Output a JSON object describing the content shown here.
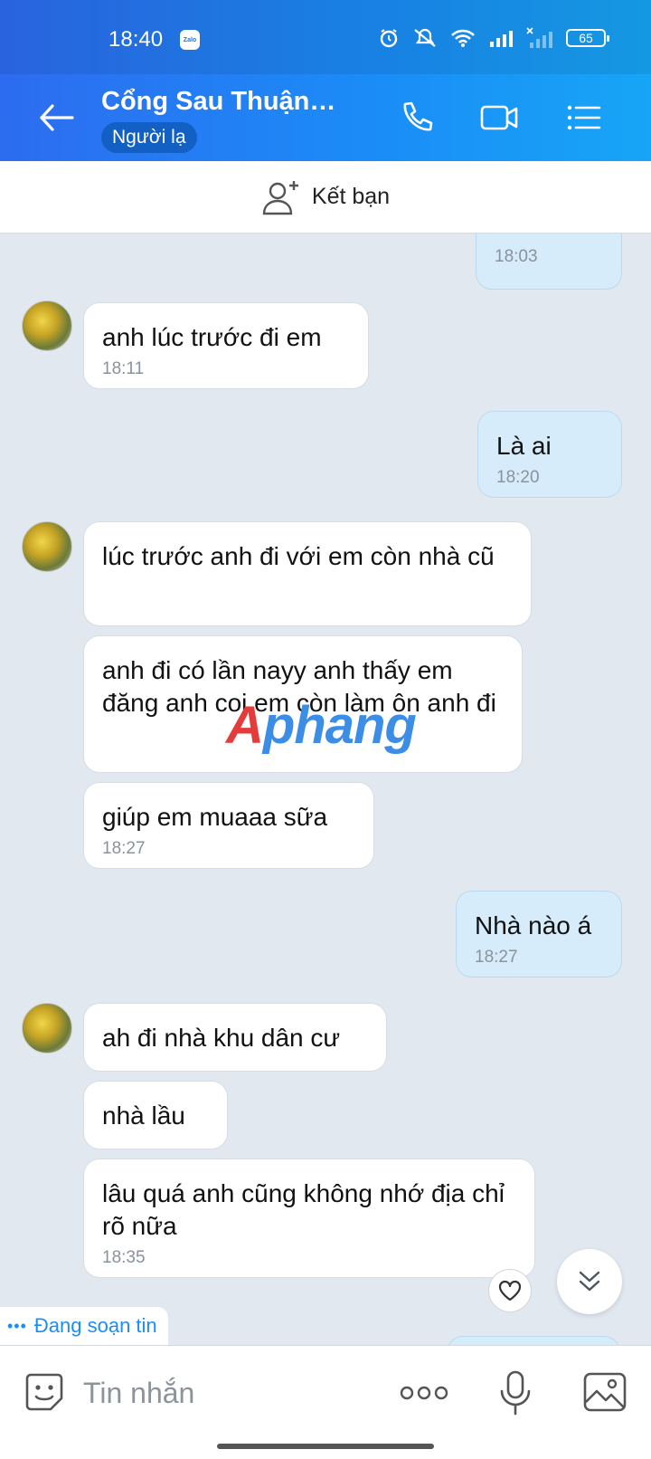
{
  "status_bar": {
    "time": "18:40",
    "app_badge": "Zalo",
    "battery": "65"
  },
  "header": {
    "title": "Cổng Sau Thuận…",
    "badge": "Người lạ"
  },
  "add_friend": {
    "label": "Kết bạn"
  },
  "messages": [
    {
      "dir": "out",
      "text": "",
      "time": "18:03"
    },
    {
      "dir": "in",
      "text": "anh lúc trước đi em",
      "time": "18:11"
    },
    {
      "dir": "out",
      "text": "Là ai",
      "time": "18:20"
    },
    {
      "dir": "in",
      "text": "lúc trước anh đi với em còn nhà cũ",
      "time": ""
    },
    {
      "dir": "in",
      "text": "anh đi có lần nayy anh thấy em đăng anh coi em còn làm ôn anh đi",
      "time": ""
    },
    {
      "dir": "in",
      "text": "giúp em muaaa sữa",
      "time": "18:27"
    },
    {
      "dir": "out",
      "text": "Nhà nào á",
      "time": "18:27"
    },
    {
      "dir": "in",
      "text": "ah đi nhà khu dân cư",
      "time": ""
    },
    {
      "dir": "in",
      "text": "nhà lầu",
      "time": ""
    },
    {
      "dir": "in",
      "text": "lâu quá anh cũng không nhớ địa chỉ rõ nữa",
      "time": "18:35"
    }
  ],
  "watermark": {
    "part1": "A",
    "part2": "phang"
  },
  "typing": {
    "label": "Đang soạn tin"
  },
  "input": {
    "placeholder": "Tin nhắn"
  },
  "colors": {
    "header_start": "#2d6cf0",
    "header_end": "#17a5f6",
    "out_bubble": "#d6ecfb",
    "accent": "#1a8ef7"
  },
  "icons": [
    "back-arrow-icon",
    "phone-icon",
    "video-call-icon",
    "menu-list-icon",
    "add-friend-icon",
    "heart-icon",
    "chevron-double-down-icon",
    "sticker-icon",
    "more-icon",
    "microphone-icon",
    "image-icon"
  ]
}
